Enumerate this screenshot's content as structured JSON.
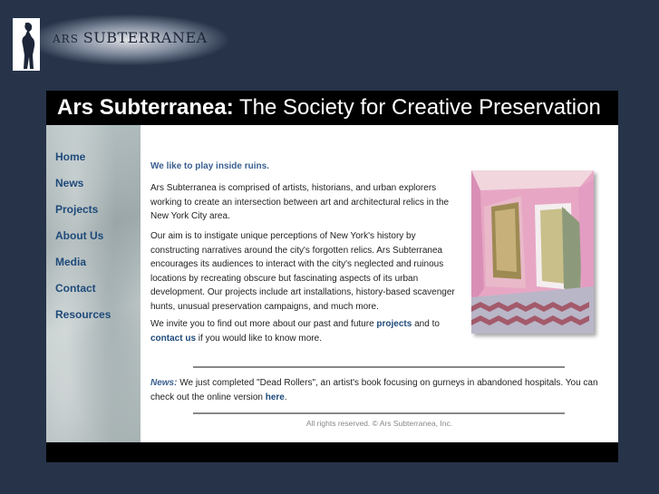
{
  "logo": {
    "text_ars": "ARS",
    "text_sub": "SUBTERRANEA"
  },
  "title": {
    "bold": "Ars Subterranea:",
    "rest": " The Society for Creative Preservation"
  },
  "nav": {
    "items": [
      {
        "label": "Home"
      },
      {
        "label": "News"
      },
      {
        "label": "Projects"
      },
      {
        "label": "About Us"
      },
      {
        "label": "Media"
      },
      {
        "label": "Contact"
      },
      {
        "label": "Resources"
      }
    ]
  },
  "content": {
    "heading": "We like to play inside ruins.",
    "para1": "Ars Subterranea is comprised of artists, historians, and urban explorers working to create an intersection between art and architectural relics in the New York City area.",
    "para2": "Our aim is to instigate unique perceptions of New York's history by constructing narratives around the city's forgotten relics. Ars Subterranea encourages its audiences to interact with the city's neglected and ruinous locations by recreating obscure but fascinating aspects of its urban development. Our projects include art installations, history-based scavenger hunts, unusual preservation campaigns, and much more.",
    "para3_a": "We invite you to find out more about our past and future ",
    "para3_link1": "projects",
    "para3_b": " and to ",
    "para3_link2": "contact us",
    "para3_c": " if you would like to know more.",
    "news_label": "News:",
    "news_text": "  We just completed \"Dead Rollers\", an artist's book focusing on gurneys in abandoned hospitals. You can check out the online version ",
    "news_link": "here",
    "news_end": "."
  },
  "footer": {
    "text": "All rights reserved. © Ars Subterranea, Inc."
  },
  "colors": {
    "page_bg": "#263349",
    "nav_link": "#1e4a7a",
    "heading_blue": "#3a5f8f"
  }
}
